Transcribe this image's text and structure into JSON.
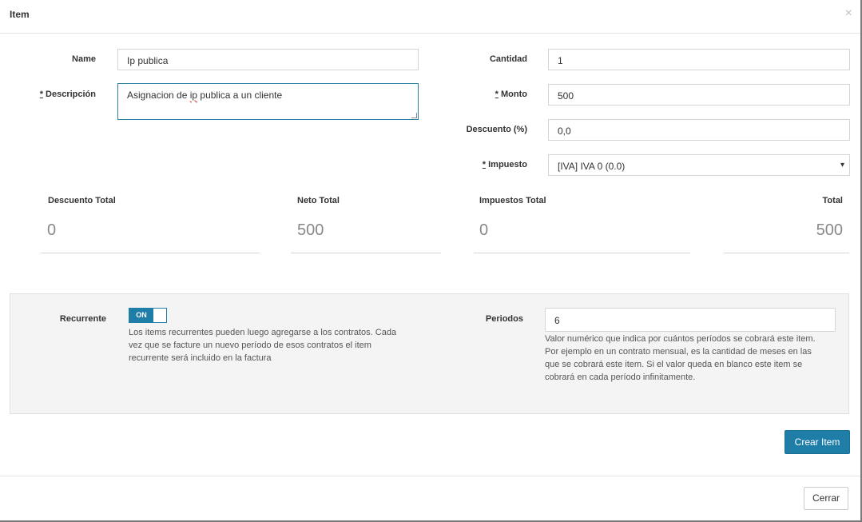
{
  "modal": {
    "title": "Item",
    "close_icon": "×"
  },
  "form": {
    "name": {
      "label": "Name",
      "value": "Ip publica"
    },
    "description": {
      "req_mark": "*",
      "label": " Descripción",
      "value_pre": "Asignacion de ",
      "value_squiggle": "ip",
      "value_post": " publica a un cliente"
    },
    "quantity": {
      "label": "Cantidad",
      "value": "1"
    },
    "amount": {
      "req_mark": "*",
      "label": " Monto",
      "value": "500"
    },
    "discount": {
      "label": "Descuento (%)",
      "value": "0,0"
    },
    "tax": {
      "req_mark": "*",
      "label": " Impuesto",
      "value": "[IVA] IVA 0 (0.0)",
      "caret": "▾"
    }
  },
  "totals": {
    "discount": {
      "label": "Descuento Total",
      "value": "0"
    },
    "net": {
      "label": "Neto Total",
      "value": "500"
    },
    "taxes": {
      "label": "Impuestos Total",
      "value": "0"
    },
    "total": {
      "label": "Total",
      "value": "500"
    }
  },
  "recurrent": {
    "label": "Recurrente",
    "toggle_label": "ON",
    "toggle_state": "on",
    "help_lines": [
      "Los items recurrentes pueden luego agregarse a los contratos. Cada",
      "vez que se facture un nuevo período de esos contratos el item",
      "recurrente será incluido en la factura"
    ],
    "periods_label": "Periodos",
    "periods_value": "6",
    "periods_help_lines": [
      "Valor numérico que indica por cuántos períodos se cobrará este item.",
      "Por ejemplo en un contrato mensual, es la cantidad de meses en las",
      "que se cobrará este item. Si el valor queda en blanco este item se",
      "cobrará en cada período infinitamente."
    ]
  },
  "buttons": {
    "create": "Crear Item",
    "close": "Cerrar"
  },
  "colors": {
    "primary": "#1e7ea8",
    "panel_bg": "#f4f4f4",
    "squiggle": "#d9534f"
  }
}
